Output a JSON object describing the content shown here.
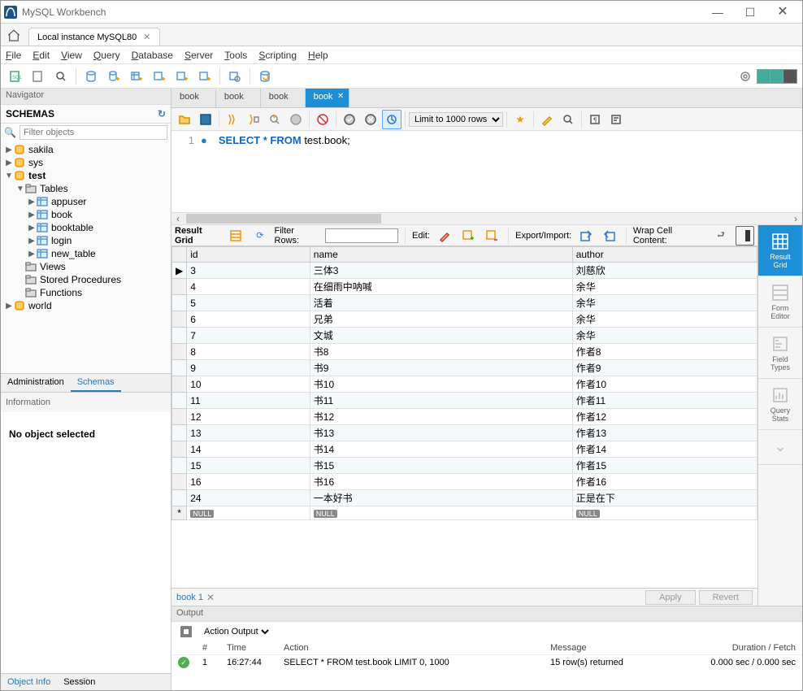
{
  "title": "MySQL Workbench",
  "connection_tab": "Local instance MySQL80",
  "menu": [
    "File",
    "Edit",
    "View",
    "Query",
    "Database",
    "Server",
    "Tools",
    "Scripting",
    "Help"
  ],
  "navigator": {
    "header": "Navigator",
    "schemas_label": "SCHEMAS",
    "filter_placeholder": "Filter objects",
    "tree": [
      {
        "label": "sakila",
        "depth": 0,
        "exp": "▶",
        "icon": "db"
      },
      {
        "label": "sys",
        "depth": 0,
        "exp": "▶",
        "icon": "db"
      },
      {
        "label": "test",
        "depth": 0,
        "exp": "▼",
        "icon": "db",
        "bold": true
      },
      {
        "label": "Tables",
        "depth": 1,
        "exp": "▼",
        "icon": "folder"
      },
      {
        "label": "appuser",
        "depth": 2,
        "exp": "▶",
        "icon": "table"
      },
      {
        "label": "book",
        "depth": 2,
        "exp": "▶",
        "icon": "table"
      },
      {
        "label": "booktable",
        "depth": 2,
        "exp": "▶",
        "icon": "table"
      },
      {
        "label": "login",
        "depth": 2,
        "exp": "▶",
        "icon": "table"
      },
      {
        "label": "new_table",
        "depth": 2,
        "exp": "▶",
        "icon": "table"
      },
      {
        "label": "Views",
        "depth": 1,
        "exp": "",
        "icon": "folder"
      },
      {
        "label": "Stored Procedures",
        "depth": 1,
        "exp": "",
        "icon": "folder"
      },
      {
        "label": "Functions",
        "depth": 1,
        "exp": "",
        "icon": "folder"
      },
      {
        "label": "world",
        "depth": 0,
        "exp": "▶",
        "icon": "db"
      }
    ],
    "tabs": [
      "Administration",
      "Schemas"
    ],
    "active_tab": 1,
    "info_header": "Information",
    "info_body": "No object selected",
    "footer_tabs": [
      "Object Info",
      "Session"
    ],
    "footer_active": 0
  },
  "sql_tabs": [
    "book",
    "book",
    "book",
    "book"
  ],
  "sql_active": 3,
  "limit_label": "Limit to 1000 rows",
  "editor_line": 1,
  "sql_text_kw": "SELECT * FROM",
  "sql_text_rest": " test.book;",
  "grid_toolbar": {
    "result_grid": "Result Grid",
    "filter_rows": "Filter Rows:",
    "edit": "Edit:",
    "export_import": "Export/Import:",
    "wrap": "Wrap Cell Content:"
  },
  "columns": [
    "id",
    "name",
    "author"
  ],
  "rows": [
    {
      "id": "3",
      "name": "三体3",
      "author": "刘慈欣"
    },
    {
      "id": "4",
      "name": "在细雨中呐喊",
      "author": "余华"
    },
    {
      "id": "5",
      "name": "活着",
      "author": "余华"
    },
    {
      "id": "6",
      "name": "兄弟",
      "author": "余华"
    },
    {
      "id": "7",
      "name": "文城",
      "author": "余华"
    },
    {
      "id": "8",
      "name": "书8",
      "author": "作者8"
    },
    {
      "id": "9",
      "name": "书9",
      "author": "作者9"
    },
    {
      "id": "10",
      "name": "书10",
      "author": "作者10"
    },
    {
      "id": "11",
      "name": "书11",
      "author": "作者11"
    },
    {
      "id": "12",
      "name": "书12",
      "author": "作者12"
    },
    {
      "id": "13",
      "name": "书13",
      "author": "作者13"
    },
    {
      "id": "14",
      "name": "书14",
      "author": "作者14"
    },
    {
      "id": "15",
      "name": "书15",
      "author": "作者15"
    },
    {
      "id": "16",
      "name": "书16",
      "author": "作者16"
    },
    {
      "id": "24",
      "name": "一本好书",
      "author": "正是在下"
    }
  ],
  "null_label": "NULL",
  "right_tabs": [
    {
      "label": "Result\nGrid"
    },
    {
      "label": "Form\nEditor"
    },
    {
      "label": "Field\nTypes"
    },
    {
      "label": "Query\nStats"
    }
  ],
  "result_tab_label": "book 1",
  "apply_label": "Apply",
  "revert_label": "Revert",
  "output": {
    "header": "Output",
    "dropdown": "Action Output",
    "cols": [
      "",
      "#",
      "Time",
      "Action",
      "Message",
      "Duration / Fetch"
    ],
    "row": {
      "num": "1",
      "time": "16:27:44",
      "action": "SELECT * FROM test.book LIMIT 0, 1000",
      "message": "15 row(s) returned",
      "duration": "0.000 sec / 0.000 sec"
    }
  }
}
